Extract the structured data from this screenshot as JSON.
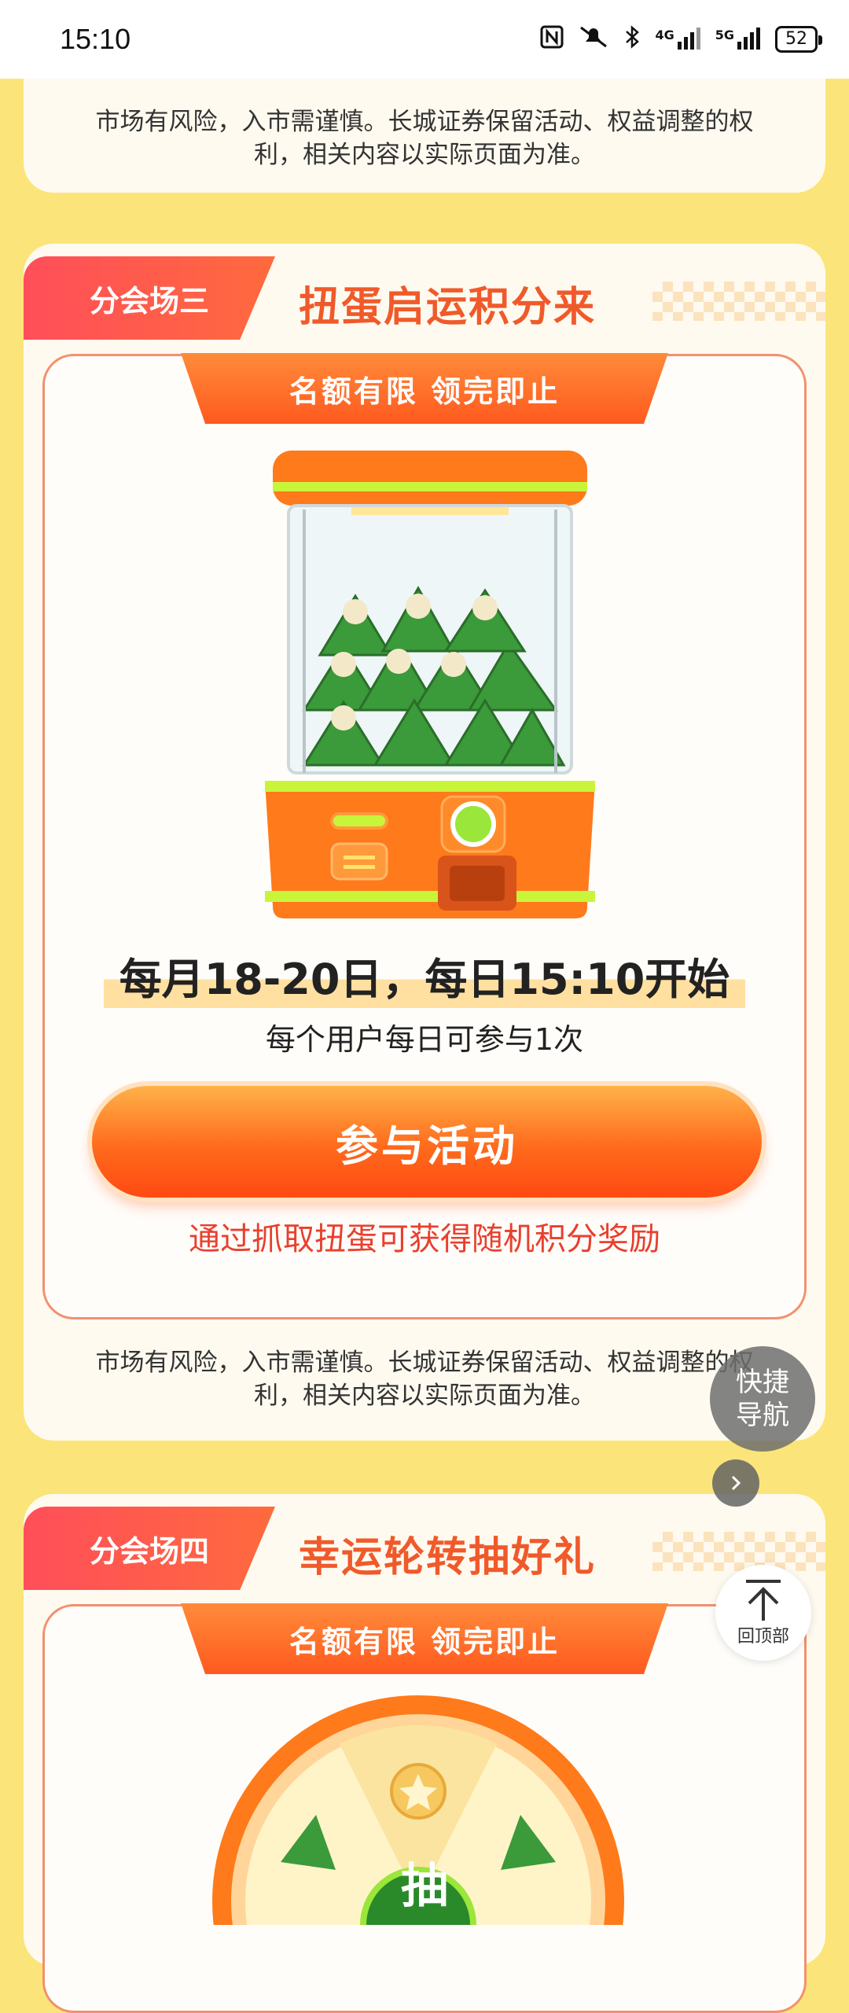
{
  "status_bar": {
    "time": "15:10",
    "battery": "52",
    "icons": [
      "nfc-icon",
      "mute-icon",
      "bluetooth-icon",
      "signal-4g-icon",
      "signal-5g-icon",
      "battery-icon"
    ],
    "net_4g": "4G",
    "net_5g": "5G"
  },
  "top_card": {
    "disclaimer": "市场有风险，入市需谨慎。长城证券保留活动、权益调整的权利，相关内容以实际页面为准。"
  },
  "venue3": {
    "tab_label": "分会场三",
    "title": "扭蛋启运积分来",
    "ribbon": "名额有限 领完即止",
    "schedule": "每月18-20日，每日15:10开始",
    "limit": "每个用户每日可参与1次",
    "button": "参与活动",
    "reward_note": "通过抓取扭蛋可获得随机积分奖励",
    "disclaimer": "市场有风险，入市需谨慎。长城证券保留活动、权益调整的权利，相关内容以实际页面为准。"
  },
  "venue4": {
    "tab_label": "分会场四",
    "title": "幸运轮转抽好礼",
    "ribbon": "名额有限 领完即止",
    "wheel_center": "抽"
  },
  "float": {
    "quick_nav_line1": "快捷",
    "quick_nav_line2": "导航",
    "back_top": "回顶部"
  },
  "colors": {
    "page_bg": "#fbe57a",
    "accent_orange": "#ff6a1c",
    "title_orange": "#f05a2a",
    "reward_red": "#e8402e"
  }
}
